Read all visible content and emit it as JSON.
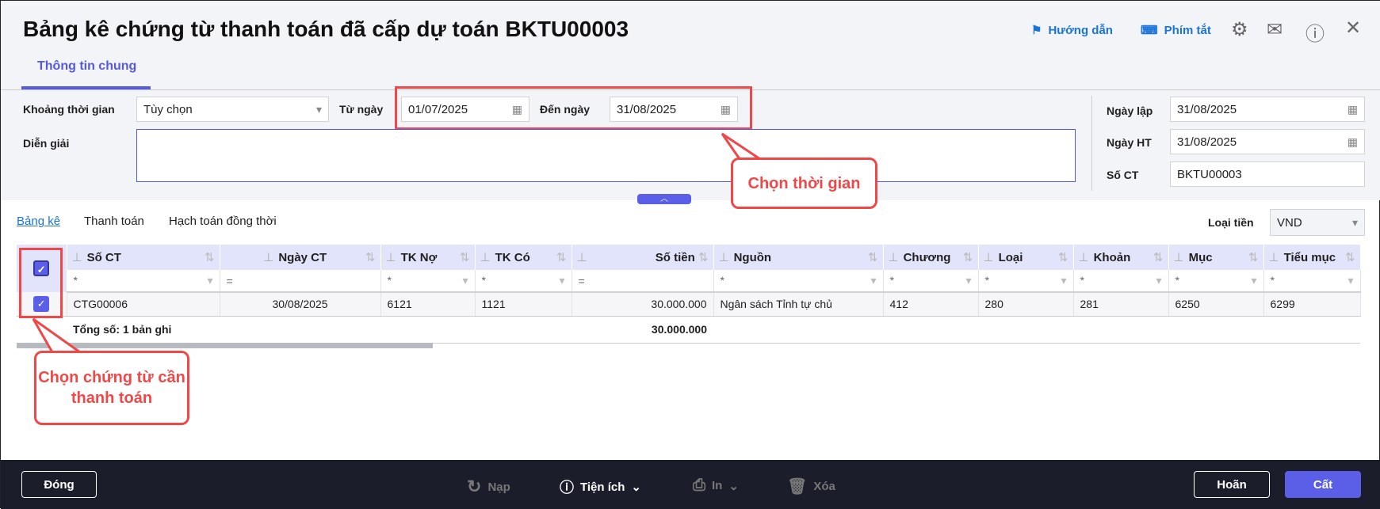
{
  "header": {
    "title": "Bảng kê chứng từ thanh toán đã cấp dự toán BKTU00003",
    "guide": "Hướng dẫn",
    "shortcuts": "Phím tắt"
  },
  "tabs": {
    "general": "Thông tin chung"
  },
  "form": {
    "period_label": "Khoảng thời gian",
    "period_value": "Tùy chọn",
    "from_label": "Từ ngày",
    "from_value": "01/07/2025",
    "to_label": "Đến ngày",
    "to_value": "31/08/2025",
    "desc_label": "Diễn giải",
    "desc_value": "",
    "created_label": "Ngày lập",
    "created_value": "31/08/2025",
    "posted_label": "Ngày HT",
    "posted_value": "31/08/2025",
    "docno_label": "Số CT",
    "docno_value": "BKTU00003"
  },
  "subtabs": [
    "Bảng kê",
    "Thanh toán",
    "Hạch toán đồng thời"
  ],
  "currency": {
    "label": "Loại tiền",
    "value": "VND"
  },
  "table": {
    "columns": [
      "Số CT",
      "Ngày CT",
      "TK Nợ",
      "TK Có",
      "Số tiền",
      "Nguồn",
      "Chương",
      "Loại",
      "Khoản",
      "Mục",
      "Tiểu mục"
    ],
    "filters": [
      "*",
      "=",
      "*",
      "*",
      "=",
      "*",
      "*",
      "*",
      "*",
      "*",
      "*"
    ],
    "rows": [
      [
        "CTG00006",
        "30/08/2025",
        "6121",
        "1121",
        "30.000.000",
        "Ngân sách Tỉnh tự chủ",
        "412",
        "280",
        "281",
        "6250",
        "6299"
      ]
    ],
    "total_label": "Tổng số: 1 bản ghi",
    "total_amount": "30.000.000"
  },
  "callouts": {
    "time": "Chọn thời gian",
    "select": "Chọn chứng từ cần thanh toán"
  },
  "footer": {
    "close": "Đóng",
    "reload": "Nạp",
    "utilities": "Tiện ích",
    "print": "In",
    "delete": "Xóa",
    "postpone": "Hoãn",
    "save": "Cất"
  }
}
